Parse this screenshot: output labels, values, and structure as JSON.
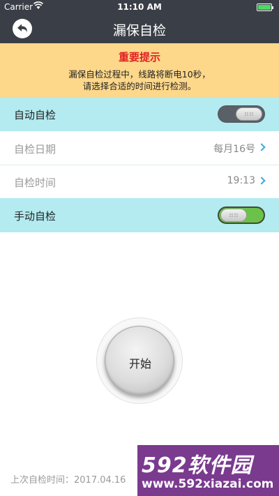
{
  "status_bar": {
    "carrier": "Carrier",
    "time": "11:10 AM",
    "icons": [
      "wifi-icon",
      "battery-icon"
    ]
  },
  "nav": {
    "title": "漏保自检",
    "back_icon": "back-arrow-icon"
  },
  "notice": {
    "title": "重要提示",
    "line1": "漏保自检过程中，线路将断电10秒，",
    "line2": "请选择合适的时间进行检测。"
  },
  "auto_check": {
    "label": "自动自检",
    "enabled": false
  },
  "check_date": {
    "label": "自检日期",
    "value": "每月16号"
  },
  "check_time": {
    "label": "自检时间",
    "value": "19:13"
  },
  "manual_check": {
    "label": "手动自检",
    "enabled": true
  },
  "start_button": {
    "label": "开始"
  },
  "last_check": {
    "text": "上次自检时间：2017.04.16"
  },
  "watermark": {
    "brand": "592软件园",
    "url": "www.592xiazai.com"
  },
  "colors": {
    "nav_bg": "#3a3f47",
    "notice_bg": "#fdd78a",
    "notice_title": "#e02020",
    "highlight_row": "#b3ebf0",
    "toggle_on": "#6cc14a",
    "chevron": "#39a8d8"
  }
}
